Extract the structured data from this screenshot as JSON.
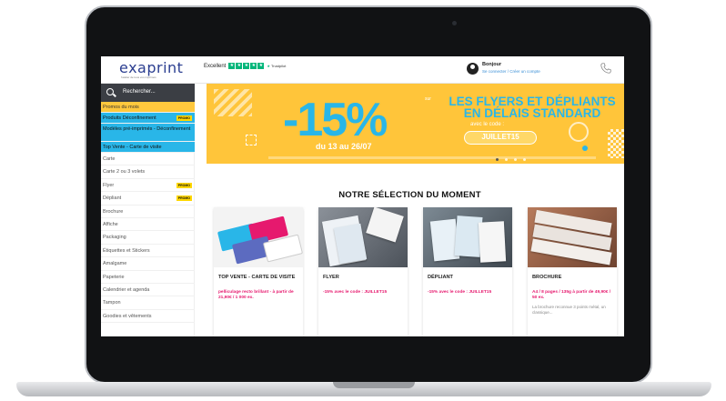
{
  "header": {
    "logo": "exaprint",
    "logo_tagline": "l'atelier de tous vos imprimés",
    "trustpilot_rating": "Excellent",
    "trustpilot_brand": "Trustpilot",
    "greeting": "Bonjour",
    "login_link": "Se connecter",
    "link_separator": " / ",
    "signup_link": "Créer un compte",
    "phone_icon": "phone-icon"
  },
  "search": {
    "placeholder": "Rechercher..."
  },
  "sidebar": {
    "items": [
      {
        "label": "Promos du mois",
        "style": "yellow",
        "badge": ""
      },
      {
        "label": "Produits Déconfinement",
        "style": "cyan",
        "badge": "PROMO"
      },
      {
        "label": "Modèles pré-imprimés - Déconfinement",
        "style": "cyan-tall",
        "badge": ""
      },
      {
        "label": "Top Vente - Carte de visite",
        "style": "cyan",
        "badge": ""
      },
      {
        "label": "Carte",
        "style": "plain",
        "badge": ""
      },
      {
        "label": "Carte 2 ou 3 volets",
        "style": "plain",
        "badge": ""
      },
      {
        "label": "Flyer",
        "style": "plain",
        "badge": "PROMO"
      },
      {
        "label": "Dépliant",
        "style": "plain",
        "badge": "PROMO"
      },
      {
        "label": "Brochure",
        "style": "plain",
        "badge": ""
      },
      {
        "label": "Affiche",
        "style": "plain",
        "badge": ""
      },
      {
        "label": "Packaging",
        "style": "plain",
        "badge": ""
      },
      {
        "label": "Étiquettes et Stickers",
        "style": "plain",
        "badge": ""
      },
      {
        "label": "Amalgame",
        "style": "plain",
        "badge": ""
      },
      {
        "label": "Papeterie",
        "style": "plain",
        "badge": ""
      },
      {
        "label": "Calendrier et agenda",
        "style": "plain",
        "badge": ""
      },
      {
        "label": "Tampon",
        "style": "plain",
        "badge": ""
      },
      {
        "label": "Goodies et vêtements",
        "style": "plain",
        "badge": ""
      }
    ]
  },
  "banner": {
    "discount": "-15%",
    "headline": "LES FLYERS ET DÉPLIANTS EN DÉLAIS STANDARD",
    "small_prefix": "sur",
    "code_hint": "avec le code :",
    "code": "JUILLET15",
    "dates": "du 13 au 26/07",
    "slide_count": 4,
    "active_slide": 1
  },
  "selection": {
    "title": "NOTRE SÉLECTION DU MOMENT",
    "cards": [
      {
        "name": "TOP VENTE - CARTE DE VISITE",
        "promo": "pelliculage recto brillant - à partir de 21,90€ / 1 000 ex.",
        "desc": ""
      },
      {
        "name": "FLYER",
        "promo": "-15% avec le code : JUILLET15",
        "desc": ""
      },
      {
        "name": "DÉPLIANT",
        "promo": "-15% avec le code : JUILLET15",
        "desc": ""
      },
      {
        "name": "BROCHURE",
        "promo": "A4 / 8 pages / 135g à partir de 49,90€ / 50 ex.",
        "desc": "La brochure reconnue 3 points métal, un classique..."
      }
    ]
  },
  "colors": {
    "brand_blue": "#2b3e90",
    "accent_cyan": "#29b6e8",
    "banner_yellow": "#ffc53a",
    "promo_pink": "#e6196e",
    "trustpilot_green": "#00b67a"
  }
}
